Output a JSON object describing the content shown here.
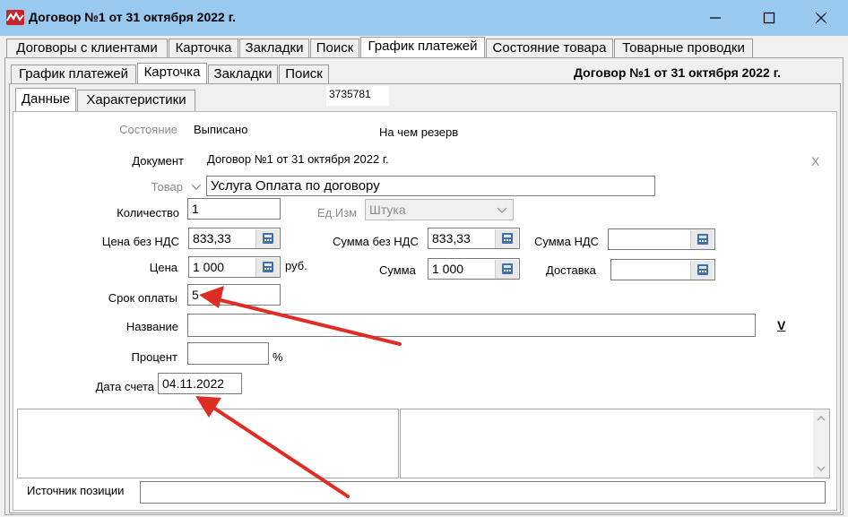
{
  "window": {
    "title": "Договор №1 от 31 октября 2022 г."
  },
  "outer_tabs": [
    {
      "label": "Договоры с клиентами"
    },
    {
      "label": "Карточка"
    },
    {
      "label": "Закладки"
    },
    {
      "label": "Поиск"
    },
    {
      "label": "График платежей"
    },
    {
      "label": "Состояние товара"
    },
    {
      "label": "Товарные проводки"
    }
  ],
  "inner_tabs": [
    {
      "label": "График платежей"
    },
    {
      "label": "Карточка"
    },
    {
      "label": "Закладки"
    },
    {
      "label": "Поиск"
    }
  ],
  "sub_tabs": [
    {
      "label": "Данные"
    },
    {
      "label": "Характеристики"
    }
  ],
  "header_contract": "Договор №1 от 31 октября 2022 г.",
  "record_id": "3735781",
  "form": {
    "state_label": "Состояние",
    "state_value": "Выписано",
    "reserve_label": "На чем резерв",
    "document_label": "Документ",
    "document_value": "Договор №1 от 31 октября 2022 г.",
    "clear_label": "X",
    "product_label": "Товар",
    "product_value": "Услуга Оплата по договору",
    "quantity_label": "Количество",
    "quantity_value": "1",
    "unit_label": "Ед.Изм",
    "unit_value": "Штука",
    "price_excl_vat_label": "Цена без НДС",
    "price_excl_vat_value": "833,33",
    "sum_excl_vat_label": "Сумма без НДС",
    "sum_excl_vat_value": "833,33",
    "vat_sum_label": "Сумма НДС",
    "vat_sum_value": "",
    "price_label": "Цена",
    "price_value": "1 000",
    "currency_label": "руб.",
    "sum_label": "Сумма",
    "sum_value": "1 000",
    "delivery_label": "Доставка",
    "delivery_value": "",
    "payment_term_label": "Срок оплаты",
    "payment_term_value": "5",
    "name_label": "Название",
    "name_value": "",
    "name_dropdown_label": "V",
    "percent_label": "Процент",
    "percent_value": "",
    "percent_unit": "%",
    "invoice_date_label": "Дата счета",
    "invoice_date_value": "04.11.2022",
    "source_label": "Источник позиции",
    "source_value": ""
  },
  "colors": {
    "titlebar": "#99c9ef",
    "annotation_arrow": "#e02d24",
    "logo": "#c7232a"
  }
}
